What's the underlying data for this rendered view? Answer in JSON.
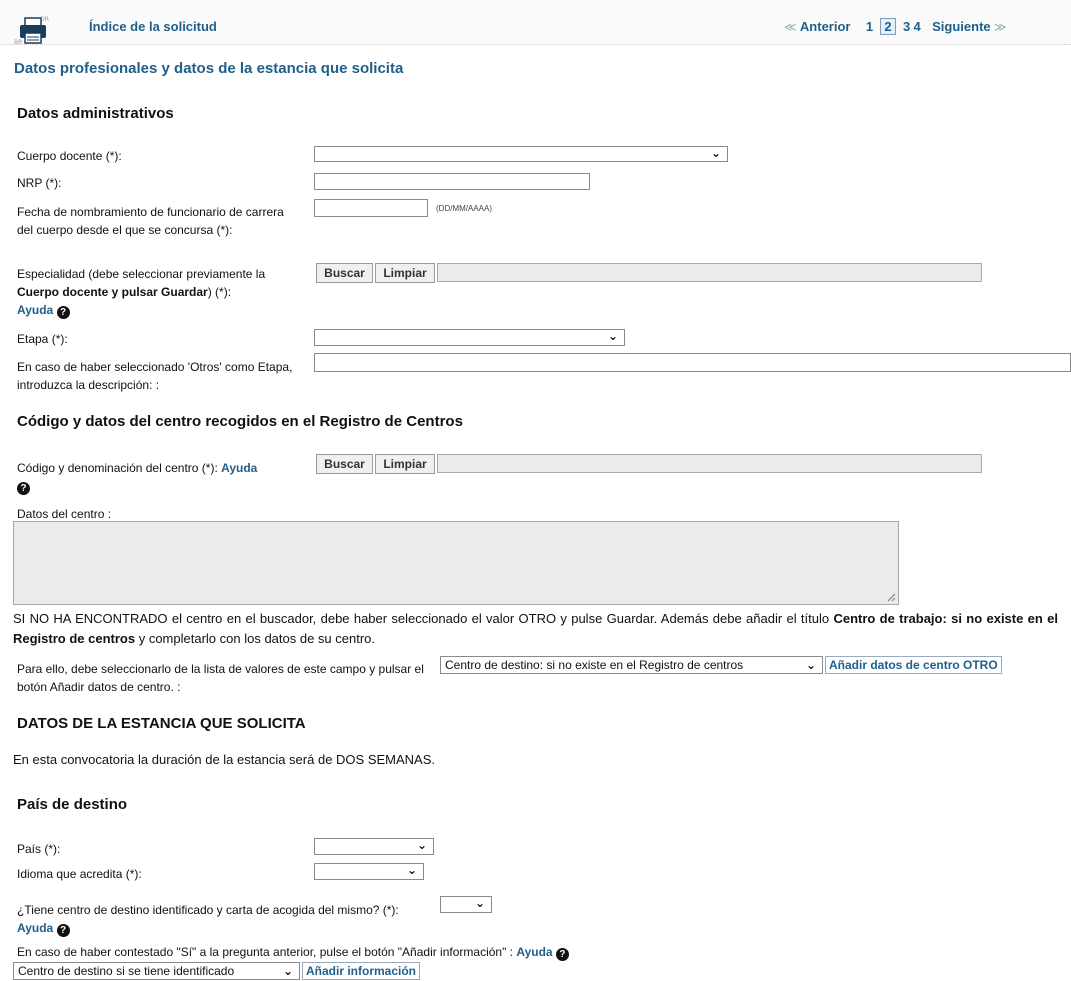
{
  "nav": {
    "index_link": "Índice de la solicitud",
    "prev": "Anterior",
    "next": "Siguiente",
    "pages": [
      "1",
      "2",
      "3",
      "4"
    ],
    "current_page": "2"
  },
  "page_title": "Datos profesionales y datos de la estancia que solicita",
  "admin": {
    "heading": "Datos administrativos",
    "cuerpo_label": "Cuerpo docente (*):",
    "nrp_label": "NRP (*):",
    "fecha_label": "Fecha de nombramiento de funcionario de carrera del cuerpo desde el que se concursa (*):",
    "fecha_hint": "(DD/MM/AAAA)",
    "esp_label_1": "Especialidad (debe seleccionar previamente la",
    "esp_label_bold": "Cuerpo docente y pulsar Guardar",
    "esp_label_2": ") (*):",
    "help": "Ayuda",
    "search_btn": "Buscar",
    "clear_btn": "Limpiar",
    "etapa_label": "Etapa (*):",
    "otros_label": "En caso de haber seleccionado 'Otros' como Etapa, introduzca la descripción: :"
  },
  "centro": {
    "heading": "Código y datos del centro recogidos en el Registro de Centros",
    "codigo_label": "Código y denominación del centro (*):",
    "help": "Ayuda",
    "search_btn": "Buscar",
    "clear_btn": "Limpiar",
    "datos_label": "Datos del centro :",
    "notice_1": "SI NO HA ENCONTRADO el centro en el buscador, debe haber seleccionado el valor OTRO y pulse Guardar. Además debe añadir el título",
    "notice_bold": "Centro de trabajo: si no existe en el Registro de centros",
    "notice_2": "y completarlo con los datos de su centro.",
    "para_label": "Para ello, debe seleccionarlo de la lista de valores de este campo y pulsar el botón Añadir datos de centro. :",
    "select_value": "Centro de destino: si no existe en el Registro de centros",
    "add_btn": "Añadir datos de centro OTRO"
  },
  "estancia": {
    "heading": "DATOS DE LA ESTANCIA QUE SOLICITA",
    "text": "En esta convocatoria la duración de la estancia será de DOS SEMANAS."
  },
  "pais": {
    "heading": "País de destino",
    "pais_label": "País (*):",
    "idioma_label": "Idioma que acredita (*):",
    "tiene_label": "¿Tiene centro de destino identificado y carta de acogida del mismo? (*):",
    "help": "Ayuda",
    "caso_label": "En caso de haber contestado \"Sí\" a la pregunta anterior, pulse el botón \"Añadir información\" :",
    "select_value": "Centro de destino si se tiene identificado",
    "add_btn": "Añadir información"
  }
}
